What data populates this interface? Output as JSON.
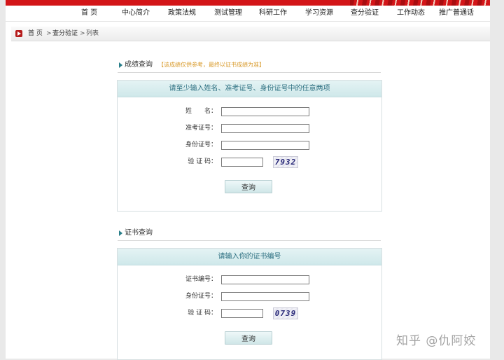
{
  "nav": {
    "items": [
      "首 页",
      "中心简介",
      "政策法规",
      "测试管理",
      "科研工作",
      "学习资源",
      "查分验证",
      "工作动态",
      "推广普通话"
    ]
  },
  "breadcrumb": {
    "home": "首 页",
    "sep1": ">",
    "section": "查分验证",
    "sep2": ">",
    "current": "列表"
  },
  "score_query": {
    "title": "成绩查询",
    "note": "【该成绩仅供参考，最终以证书成绩为准】",
    "panel_title": "请至少输入姓名、准考证号、身份证号中的任意两项",
    "fields": [
      {
        "label": "姓　　名：",
        "value": ""
      },
      {
        "label": "准考证号：",
        "value": ""
      },
      {
        "label": "身份证号：",
        "value": ""
      }
    ],
    "captcha_label": "验 证 码：",
    "captcha_value": "",
    "captcha_text": "7932",
    "button": "查询"
  },
  "cert_query": {
    "title": "证书查询",
    "panel_title": "请输入你的证书编号",
    "fields": [
      {
        "label": "证书编号：",
        "value": ""
      },
      {
        "label": "身份证号：",
        "value": ""
      }
    ],
    "captcha_label": "验 证 码：",
    "captcha_value": "",
    "captcha_text": "0739",
    "button": "查询"
  },
  "watermark": "知乎 @仇阿姣",
  "colors": {
    "brand_red": "#d31518",
    "panel_title": "#2c6f80",
    "note": "#d89a2a"
  }
}
